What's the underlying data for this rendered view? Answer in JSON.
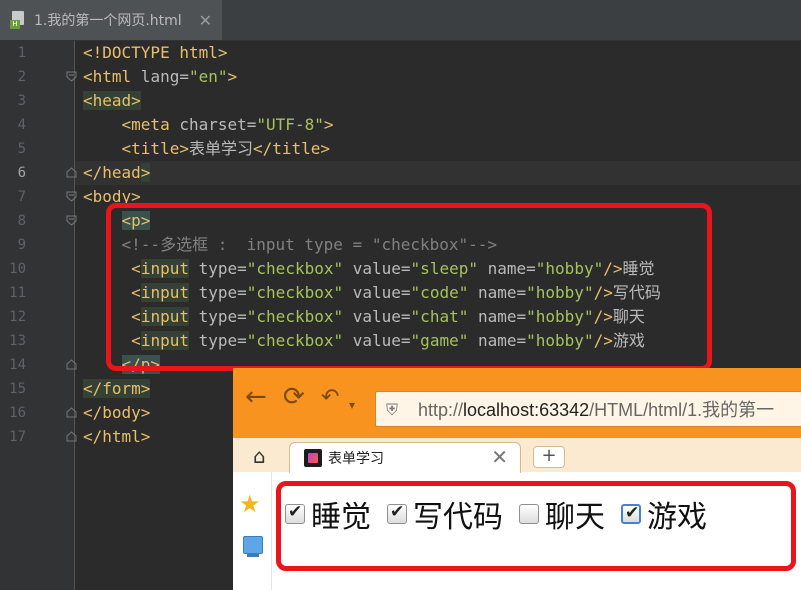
{
  "editor": {
    "file_tab": {
      "title": "1.我的第一个网页.html",
      "close": "✕",
      "badge": "H"
    },
    "current_line": 6,
    "lines": [
      {
        "n": "1"
      },
      {
        "n": "2"
      },
      {
        "n": "3"
      },
      {
        "n": "4"
      },
      {
        "n": "5"
      },
      {
        "n": "6"
      },
      {
        "n": "7"
      },
      {
        "n": "8"
      },
      {
        "n": "9"
      },
      {
        "n": "10"
      },
      {
        "n": "11"
      },
      {
        "n": "12"
      },
      {
        "n": "13"
      },
      {
        "n": "14"
      },
      {
        "n": "15"
      },
      {
        "n": "16"
      },
      {
        "n": "17"
      }
    ],
    "code": {
      "doctype": "<!DOCTYPE html>",
      "html_open": "<html",
      "lang_attr": " lang=",
      "lang_val": "\"en\"",
      "gt": ">",
      "head_open": "<head>",
      "meta_open": "<meta",
      "charset_attr": " charset=",
      "charset_val": "\"UTF-8\"",
      "title_open": "<title>",
      "title_text": "表单学习",
      "title_close": "</title>",
      "head_close_a": "</head",
      "body_open": "<body>",
      "p_open": "<p>",
      "comment": "<!--多选框 :  input type = \"checkbox\"-->",
      "inputs": [
        {
          "value": "\"sleep\"",
          "label": "睡觉"
        },
        {
          "value": "\"code\"",
          "label": "写代码"
        },
        {
          "value": "\"chat\"",
          "label": "聊天"
        },
        {
          "value": "\"game\"",
          "label": "游戏"
        }
      ],
      "lt": "<",
      "input_tag": "input",
      "type_attr": " type=",
      "type_val": "\"checkbox\"",
      "value_attr": " value=",
      "name_attr": " name=",
      "name_val": "\"hobby\"",
      "self_close": "/>",
      "p_close": "</p>",
      "form_close": "</form>",
      "body_close": "</body>",
      "html_close": "</html>"
    }
  },
  "browser": {
    "url_prefix": "http://",
    "url_host": "localhost:63342",
    "url_path": "/HTML/html/1.我的第一",
    "tab_title": "表单学习",
    "tab_close": "✕",
    "new_tab": "+",
    "checkboxes": [
      {
        "label": "睡觉",
        "checked": true
      },
      {
        "label": "写代码",
        "checked": true
      },
      {
        "label": "聊天",
        "checked": false
      },
      {
        "label": "游戏",
        "checked": true
      }
    ]
  },
  "colors": {
    "highlight_box": "#e8151b",
    "browser_chrome": "#f7931e"
  }
}
